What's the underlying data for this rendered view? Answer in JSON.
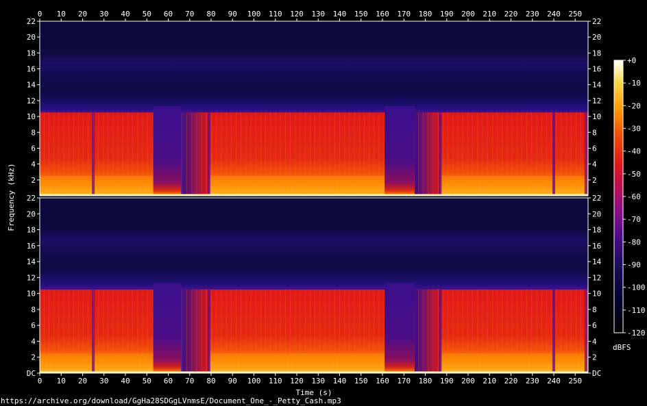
{
  "chart_data": {
    "type": "heatmap",
    "description_channels": 2,
    "xlabel": "Time (s)",
    "ylabel": "Frequency (kHz)",
    "x_ticks": [
      0,
      10,
      20,
      30,
      40,
      50,
      60,
      70,
      80,
      90,
      100,
      110,
      120,
      130,
      140,
      150,
      160,
      170,
      180,
      190,
      200,
      210,
      220,
      230,
      240,
      250
    ],
    "xlim": [
      0,
      256
    ],
    "y_ticks_top": [
      "22",
      "20",
      "18",
      "16",
      "14",
      "12",
      "10",
      "8",
      "6",
      "4",
      "2"
    ],
    "y_ticks_bottom": [
      "22",
      "20",
      "18",
      "16",
      "14",
      "12",
      "10",
      "8",
      "6",
      "4",
      "2",
      "DC"
    ],
    "ylim_khz": [
      0,
      22
    ],
    "colorbar": {
      "label": "dBFS",
      "ticks": [
        "+0",
        "-10",
        "-20",
        "-30",
        "-40",
        "-50",
        "-60",
        "-70",
        "-80",
        "-90",
        "-100",
        "-110",
        "-120"
      ],
      "range": [
        -120,
        0
      ]
    },
    "lowpass_cutoff_khz": 10.5,
    "quiet_sections_s": [
      [
        53,
        66
      ],
      [
        161,
        175
      ]
    ],
    "fade_in_sections_s": [
      [
        66,
        79
      ],
      [
        175,
        187
      ]
    ],
    "section_breaks_s": [
      25,
      79,
      187,
      240,
      255
    ]
  },
  "footer": {
    "url": "https://archive.org/download/GgHa28SDGgLVnmsE/Document_One_-_Petty_Cash.mp3"
  }
}
